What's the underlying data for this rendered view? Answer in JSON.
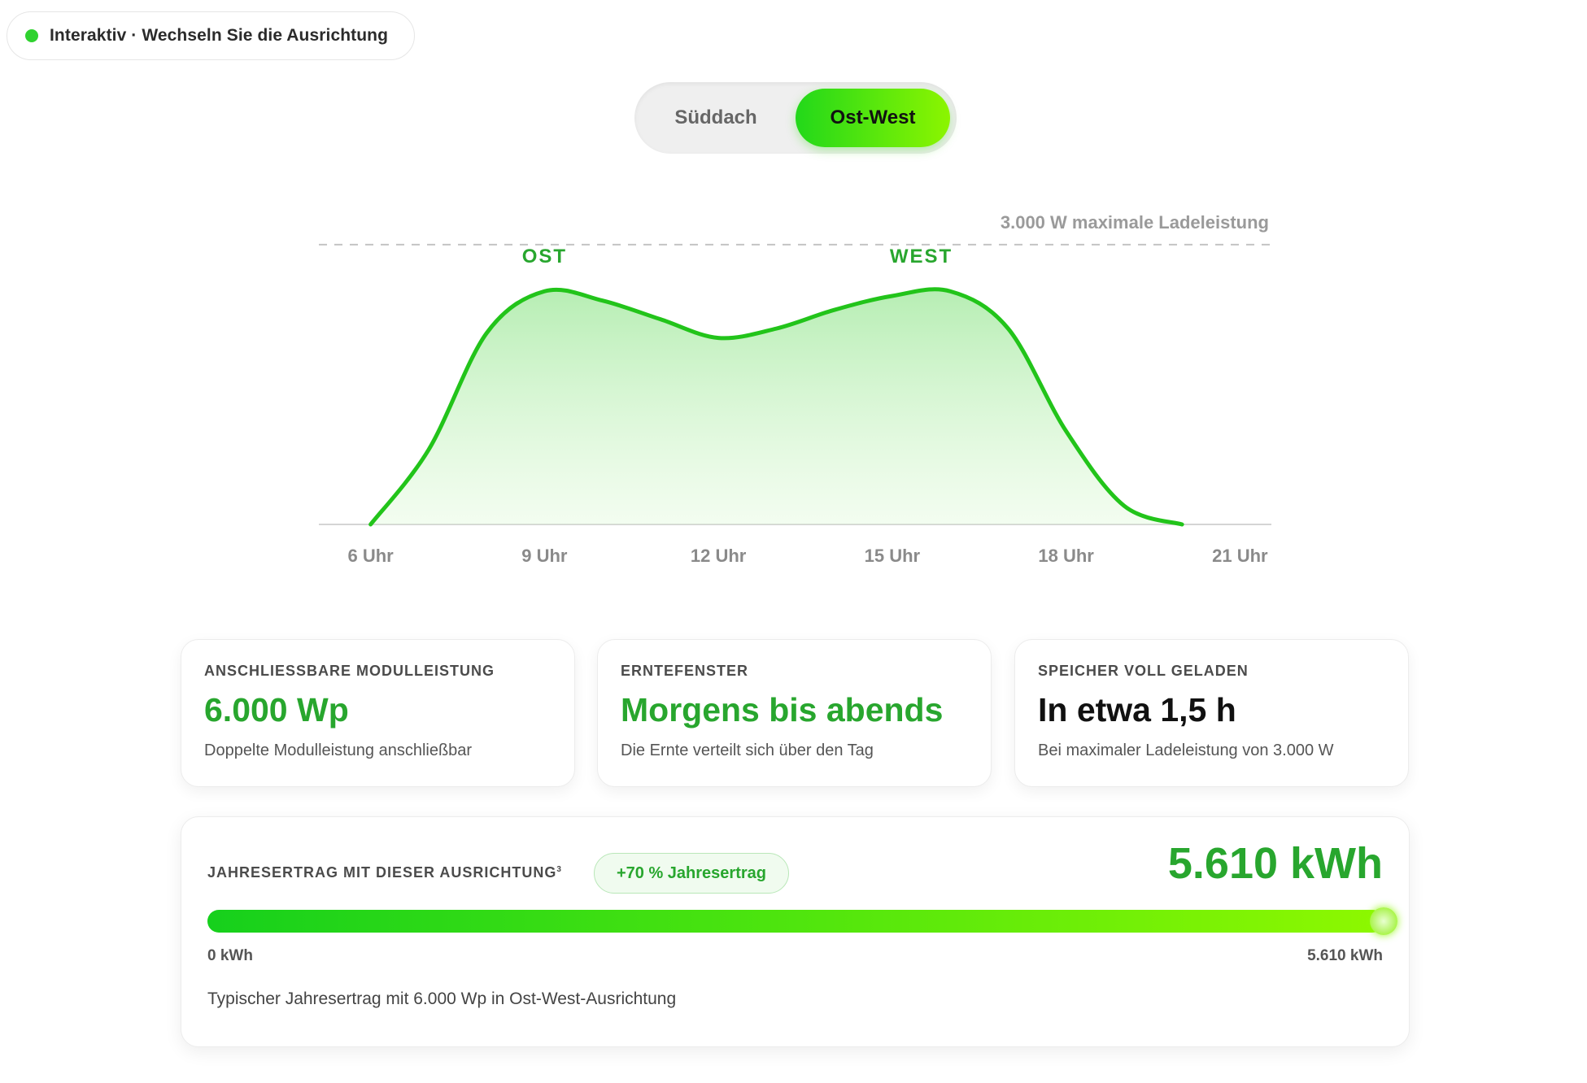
{
  "badge": {
    "text": "Interaktiv · Wechseln Sie die Ausrichtung",
    "dot_color": "#2fd22f"
  },
  "toggle": {
    "options": [
      "Süddach",
      "Ost-West"
    ],
    "selected": "Ost-West"
  },
  "chart_data": {
    "type": "area",
    "x": [
      6,
      7,
      8,
      9,
      10,
      11,
      12,
      13,
      14,
      15,
      16,
      17,
      18,
      19,
      20
    ],
    "values": [
      0,
      800,
      2050,
      2500,
      2400,
      2200,
      2000,
      2100,
      2300,
      2450,
      2500,
      2100,
      1000,
      200,
      0
    ],
    "series_color": "#22c41a",
    "xticks": [
      {
        "value": 6,
        "label": "6 Uhr"
      },
      {
        "value": 9,
        "label": "9 Uhr"
      },
      {
        "value": 12,
        "label": "12 Uhr"
      },
      {
        "value": 15,
        "label": "15 Uhr"
      },
      {
        "value": 18,
        "label": "18 Uhr"
      },
      {
        "value": 21,
        "label": "21 Uhr"
      }
    ],
    "xlim": [
      5.5,
      21.5
    ],
    "ylim": [
      0,
      3400
    ],
    "reference_line": {
      "value": 3000,
      "label": "3.000 W maximale Ladeleistung"
    },
    "annotations": [
      {
        "x": 9,
        "label": "OST"
      },
      {
        "x": 15.5,
        "label": "WEST"
      }
    ],
    "grid": false
  },
  "cards": [
    {
      "label": "ANSCHLIESSBARE MODULLEISTUNG",
      "value": "6.000 Wp",
      "sub": "Doppelte Modulleistung anschließbar"
    },
    {
      "label": "ERNTEFENSTER",
      "value": "Morgens bis abends",
      "sub": "Die Ernte verteilt sich über den Tag"
    },
    {
      "label": "SPEICHER VOLL GELADEN",
      "value": "In etwa 1,5 h",
      "sub": "Bei maximaler Ladeleistung von 3.000 W"
    }
  ],
  "yield": {
    "label": "JAHRESERTRAG MIT DIESER AUSRICHTUNG",
    "footnote": "3",
    "pill": "+70 % Jahresertrag",
    "value": "5.610 kWh",
    "progress": 1.0,
    "min_label": "0 kWh",
    "max_label": "5.610 kWh",
    "note": "Typischer Jahresertrag mit 6.000 Wp in Ost-West-Ausrichtung"
  },
  "colors": {
    "accent": "#28a62e",
    "gradient_start": "#22d81a",
    "gradient_end": "#8cf500"
  }
}
